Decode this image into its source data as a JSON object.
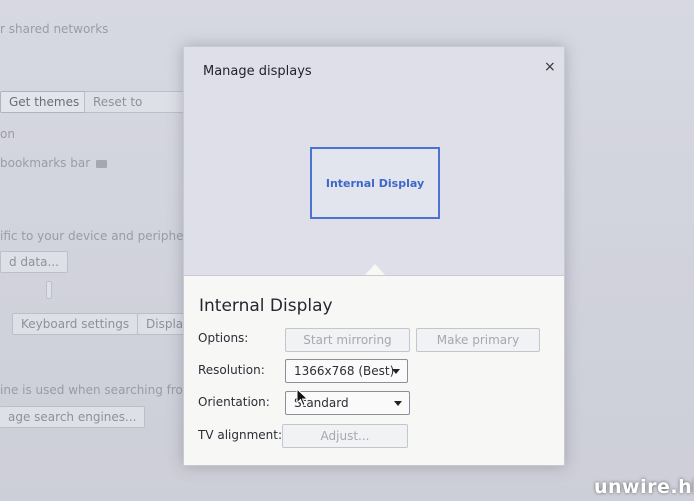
{
  "background": {
    "shared_networks": "r shared networks",
    "get_themes": "Get themes",
    "reset_to_default": "Reset to default",
    "section_fragment": "on",
    "bookmarks_bar": "bookmarks bar",
    "device_fragment": "ific to your device and peripherals",
    "data_button": "d data...",
    "keyboard_settings": "Keyboard settings",
    "display_fragment": "Display",
    "search_fragment": "ine is used when searching from t",
    "manage_search_engines": "age search engines..."
  },
  "dialog": {
    "title": "Manage displays",
    "close_glyph": "×",
    "display_box_label": "Internal Display",
    "section_title": "Internal Display",
    "options_label": "Options:",
    "start_mirroring": "Start mirroring",
    "make_primary": "Make primary",
    "resolution_label": "Resolution:",
    "resolution_value": "1366x768 (Best)",
    "orientation_label": "Orientation:",
    "orientation_value": "Standard",
    "tv_alignment_label": "TV alignment:",
    "adjust": "Adjust..."
  },
  "watermark": "unwire.hk",
  "colors": {
    "accent": "#4a74d0",
    "dialog_header": "#dedfe8",
    "dialog_body": "#f7f8f6"
  }
}
